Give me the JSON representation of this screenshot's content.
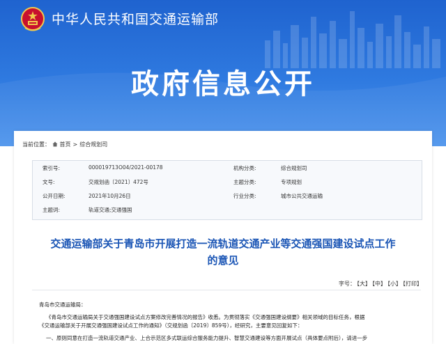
{
  "header": {
    "ministry": "中华人民共和国交通运输部",
    "banner_title": "政府信息公开"
  },
  "breadcrumb": {
    "prefix": "当前位置：",
    "home": "首页",
    "sep": ">",
    "current": "综合规划司"
  },
  "meta": {
    "rows": [
      {
        "l1": "索引号:",
        "v1": "000019713O04/2021-00178",
        "l2": "机构分类:",
        "v2": "综合规划司"
      },
      {
        "l1": "文号:",
        "v1": "交规划函〔2021〕472号",
        "l2": "主题分类:",
        "v2": "专项规划"
      },
      {
        "l1": "公开日期:",
        "v1": "2021年10月26日",
        "l2": "行业分类:",
        "v2": "城市公共交通运输"
      },
      {
        "l1": "主题词:",
        "v1": "轨道交通;交通强国",
        "l2": "",
        "v2": ""
      }
    ]
  },
  "article": {
    "title_line1": "交通运输部关于青岛市开展打造一流轨道交通产业等交通强国建设试点工作",
    "title_line2": "的意见",
    "addressee": "青岛市交通运输局：",
    "para1_line1": "《青岛市交通运输局关于交通强国建设试点方案修改完善情况的报告》收悉。为贯彻落实《交通强国建设纲要》相关领域的目标任务，根据",
    "para1_line2": "《交通运输部关于开展交通强国建设试点工作的通知》（交规划函〔2019〕859号），经研究，主要意见回复如下：",
    "para2_line1": "一、原则同意在打造一流轨道交通产业、上合示范区多式联运综合服务能力提升、智慧交通建设等方面开展试点（具体要点附后），请进一步"
  },
  "toolbar": {
    "label": "字号：",
    "big": "【大】",
    "mid": "【中】",
    "small": "【小】",
    "print": "【打印】"
  },
  "colors": {
    "banner": "#2f7ae0",
    "title": "#1a55b5",
    "emblem_red": "#c8102e",
    "emblem_gold": "#f2c94c"
  }
}
